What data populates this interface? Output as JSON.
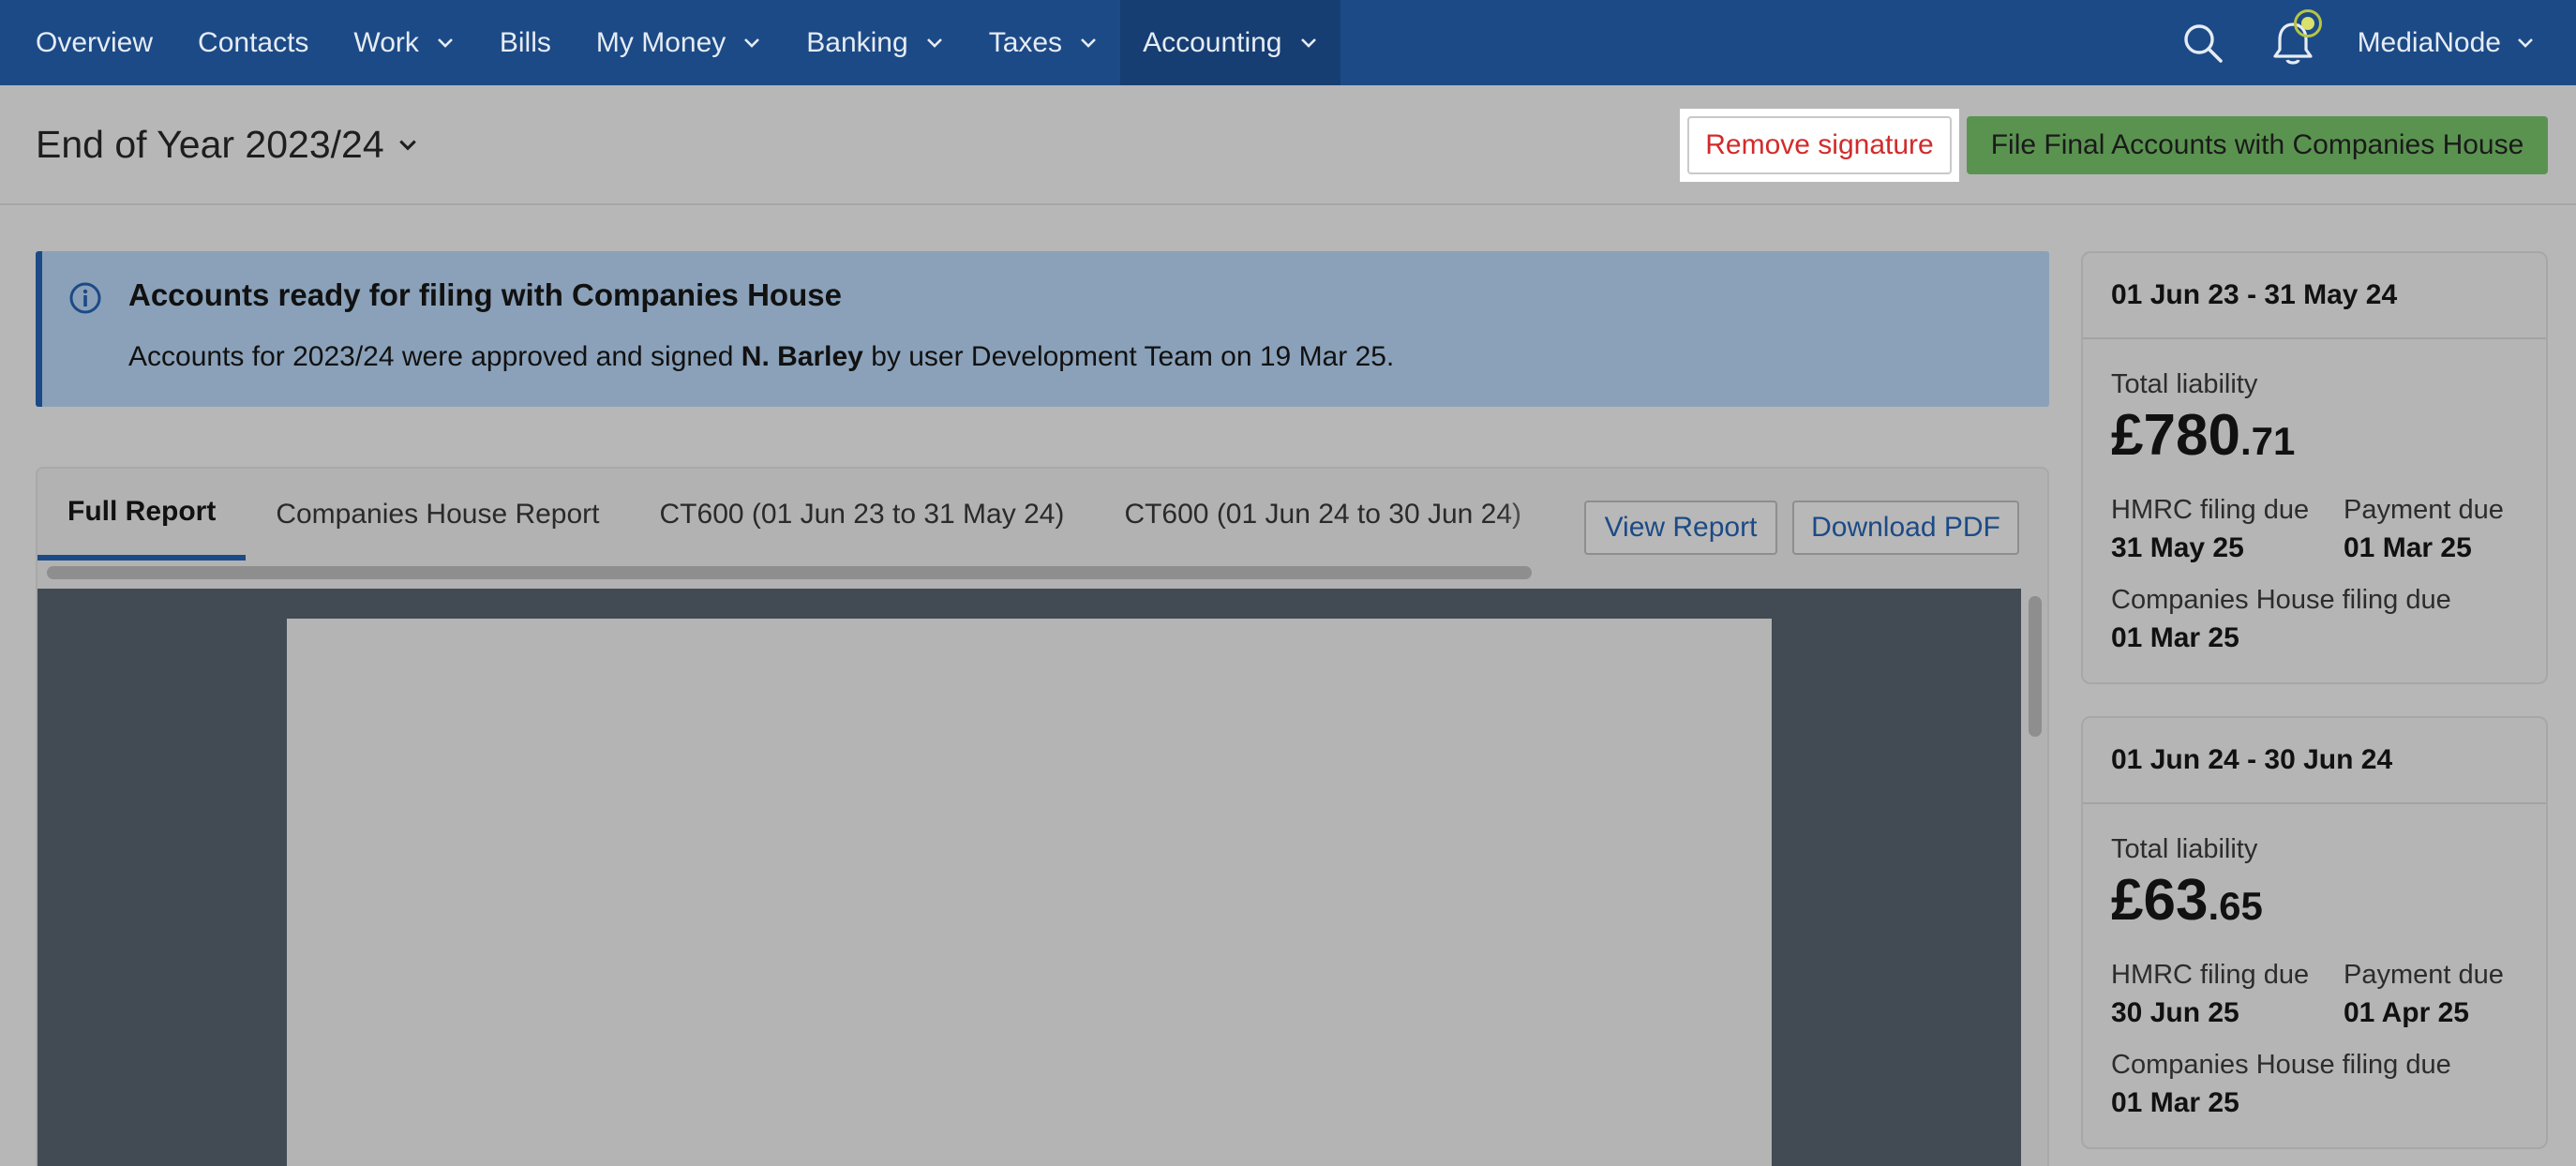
{
  "nav": {
    "items": [
      {
        "label": "Overview",
        "has_menu": false
      },
      {
        "label": "Contacts",
        "has_menu": false
      },
      {
        "label": "Work",
        "has_menu": true
      },
      {
        "label": "Bills",
        "has_menu": false
      },
      {
        "label": "My Money",
        "has_menu": true
      },
      {
        "label": "Banking",
        "has_menu": true
      },
      {
        "label": "Taxes",
        "has_menu": true
      },
      {
        "label": "Accounting",
        "has_menu": true,
        "active": true
      }
    ],
    "account_name": "MediaNode",
    "icons": [
      "search-icon",
      "bell-icon"
    ]
  },
  "header": {
    "year_title": "End of Year 2023/24",
    "remove_signature_label": "Remove signature",
    "file_accounts_label": "File Final Accounts with Companies House"
  },
  "banner": {
    "title": "Accounts ready for filing with Companies House",
    "text_before": "Accounts for 2023/24 were approved and signed ",
    "signer": "N. Barley",
    "text_after": " by user Development Team on 19 Mar 25."
  },
  "report": {
    "tabs": [
      {
        "label": "Full Report",
        "active": true
      },
      {
        "label": "Companies House Report",
        "active": false
      },
      {
        "label": "CT600 (01 Jun 23 to 31 May 24)",
        "active": false
      },
      {
        "label": "CT600 (01 Jun 24 to 30 Jun 24)",
        "active": false
      }
    ],
    "view_report_label": "View Report",
    "download_pdf_label": "Download PDF"
  },
  "cards": [
    {
      "period": "01 Jun 23 - 31 May 24",
      "liability_label": "Total liability",
      "amount_main": "£780",
      "amount_pence": ".71",
      "hmrc_label": "HMRC filing due",
      "hmrc_value": "31 May 25",
      "payment_label": "Payment due",
      "payment_value": "01 Mar 25",
      "ch_label": "Companies House filing due",
      "ch_value": "01 Mar 25"
    },
    {
      "period": "01 Jun 24 - 30 Jun 24",
      "liability_label": "Total liability",
      "amount_main": "£63",
      "amount_pence": ".65",
      "hmrc_label": "HMRC filing due",
      "hmrc_value": "30 Jun 25",
      "payment_label": "Payment due",
      "payment_value": "01 Apr 25",
      "ch_label": "Companies House filing due",
      "ch_value": "01 Mar 25"
    }
  ],
  "colors": {
    "nav_bg": "#1c4a86",
    "danger": "#d12b2b",
    "success": "#5a9350",
    "info_bg": "#8aa1b9"
  }
}
